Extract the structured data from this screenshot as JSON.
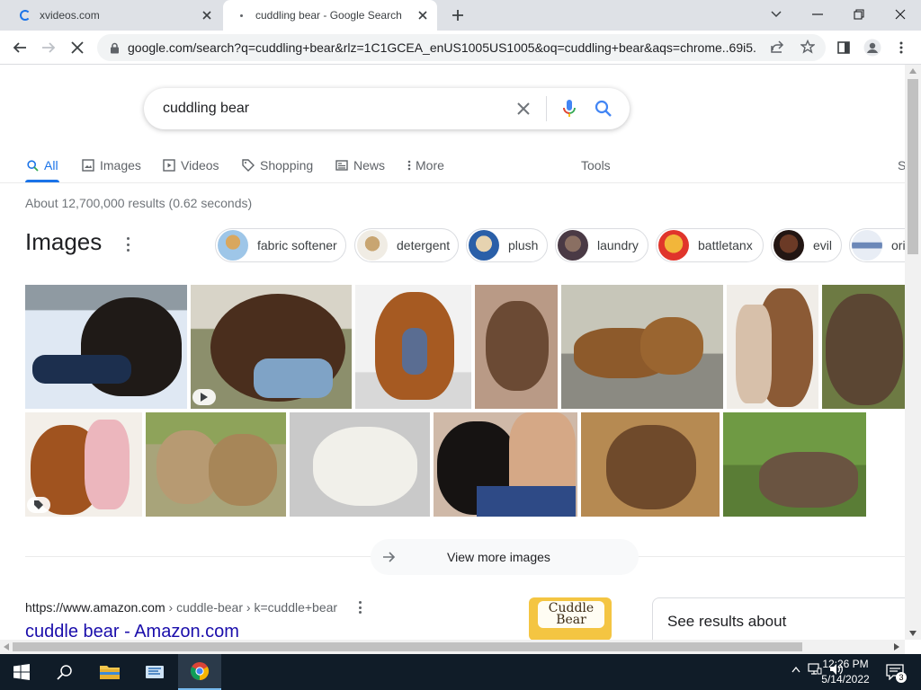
{
  "browser": {
    "tabs": [
      {
        "title": "xvideos.com",
        "loading": true
      },
      {
        "title": "cuddling bear - Google Search",
        "active": true
      }
    ],
    "url": "google.com/search?q=cuddling+bear&rlz=1C1GCEA_enUS1005US1005&oq=cuddling+bear&aqs=chrome..69i5..."
  },
  "search": {
    "query": "cuddling bear",
    "nav": {
      "all": "All",
      "images": "Images",
      "videos": "Videos",
      "shopping": "Shopping",
      "news": "News",
      "more": "More",
      "tools": "Tools",
      "partial": "S"
    },
    "stats": "About 12,700,000 results (0.62 seconds)"
  },
  "images_section": {
    "heading": "Images",
    "chips": [
      "fabric softener",
      "detergent",
      "plush",
      "laundry",
      "battletanx",
      "evil",
      "ori"
    ],
    "view_more": "View more images"
  },
  "result": {
    "cite_domain": "https://www.amazon.com",
    "cite_path": " › cuddle-bear › k=cuddle+bear",
    "title": "cuddle bear - Amazon.com",
    "thumb_text": "Cuddle Bear"
  },
  "side_panel": {
    "label": "See results about"
  },
  "taskbar": {
    "time": "12:26 PM",
    "date": "5/14/2022",
    "notification_count": "3"
  },
  "colors": {
    "link": "#1a0dab",
    "accent": "#1a73e8",
    "taskbar": "#101c28"
  }
}
